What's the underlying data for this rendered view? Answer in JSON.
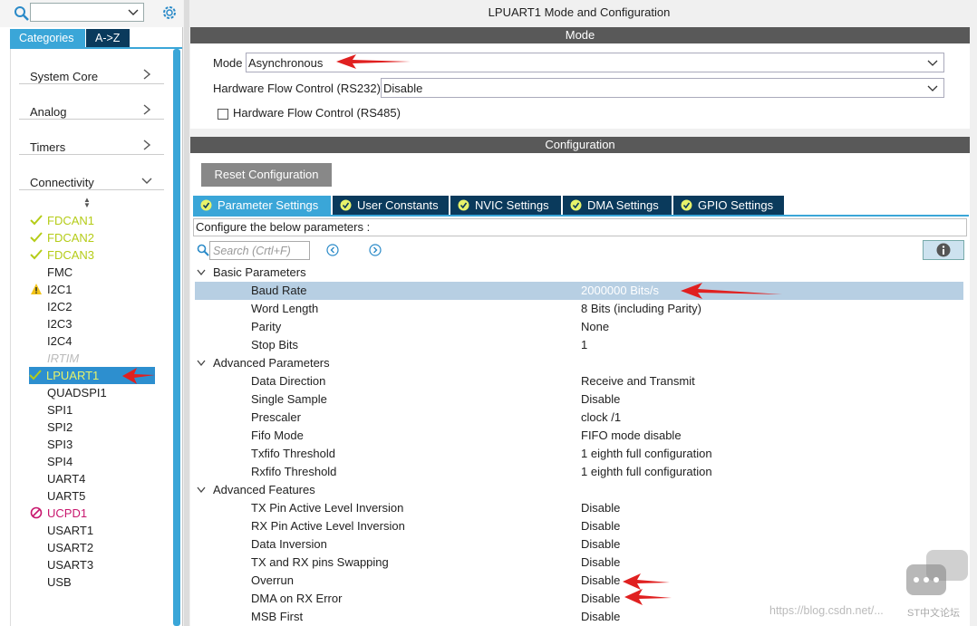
{
  "left": {
    "category_search": {
      "value": ""
    },
    "tabs": [
      {
        "label": "Categories"
      },
      {
        "label": "A->Z"
      }
    ],
    "categories": [
      {
        "label": "System Core",
        "state": "collapsed"
      },
      {
        "label": "Analog",
        "state": "collapsed"
      },
      {
        "label": "Timers",
        "state": "collapsed"
      },
      {
        "label": "Connectivity",
        "state": "expanded"
      }
    ],
    "peripherals": [
      {
        "label": "FDCAN1",
        "status": "ok"
      },
      {
        "label": "FDCAN2",
        "status": "ok"
      },
      {
        "label": "FDCAN3",
        "status": "ok"
      },
      {
        "label": "FMC",
        "status": "none"
      },
      {
        "label": "I2C1",
        "status": "warning"
      },
      {
        "label": "I2C2",
        "status": "none"
      },
      {
        "label": "I2C3",
        "status": "none"
      },
      {
        "label": "I2C4",
        "status": "none"
      },
      {
        "label": "IRTIM",
        "status": "disabled"
      },
      {
        "label": "LPUART1",
        "status": "ok",
        "selected": true
      },
      {
        "label": "QUADSPI1",
        "status": "none"
      },
      {
        "label": "SPI1",
        "status": "none"
      },
      {
        "label": "SPI2",
        "status": "none"
      },
      {
        "label": "SPI3",
        "status": "none"
      },
      {
        "label": "SPI4",
        "status": "none"
      },
      {
        "label": "UART4",
        "status": "none"
      },
      {
        "label": "UART5",
        "status": "none"
      },
      {
        "label": "UCPD1",
        "status": "error"
      },
      {
        "label": "USART1",
        "status": "none"
      },
      {
        "label": "USART2",
        "status": "none"
      },
      {
        "label": "USART3",
        "status": "none"
      },
      {
        "label": "USB",
        "status": "none"
      }
    ]
  },
  "right": {
    "title": "LPUART1 Mode and Configuration",
    "mode_header": "Mode",
    "mode_fields": {
      "mode_label": "Mode",
      "mode_value": "Asynchronous",
      "hfc232_label": "Hardware Flow Control (RS232)",
      "hfc232_value": "Disable",
      "hfc485_label": "Hardware Flow Control (RS485)"
    },
    "config_header": "Configuration",
    "reset_button": "Reset Configuration",
    "tabs": [
      {
        "label": "Parameter Settings",
        "active": true
      },
      {
        "label": "User Constants"
      },
      {
        "label": "NVIC Settings"
      },
      {
        "label": "DMA Settings"
      },
      {
        "label": "GPIO Settings"
      }
    ],
    "hint": "Configure the below parameters :",
    "param_search_placeholder": "Search (Crtl+F)",
    "groups": [
      {
        "label": "Basic Parameters",
        "params": [
          {
            "name": "Baud Rate",
            "value": "2000000 Bits/s",
            "highlighted": true
          },
          {
            "name": "Word Length",
            "value": "8 Bits (including Parity)"
          },
          {
            "name": "Parity",
            "value": "None"
          },
          {
            "name": "Stop Bits",
            "value": "1"
          }
        ]
      },
      {
        "label": "Advanced Parameters",
        "params": [
          {
            "name": "Data Direction",
            "value": "Receive and Transmit"
          },
          {
            "name": "Single Sample",
            "value": "Disable"
          },
          {
            "name": "Prescaler",
            "value": "clock /1"
          },
          {
            "name": "Fifo Mode",
            "value": "FIFO mode disable"
          },
          {
            "name": "Txfifo Threshold",
            "value": "1 eighth full configuration"
          },
          {
            "name": "Rxfifo Threshold",
            "value": "1 eighth full configuration"
          }
        ]
      },
      {
        "label": "Advanced Features",
        "params": [
          {
            "name": "TX Pin Active Level Inversion",
            "value": "Disable"
          },
          {
            "name": "RX Pin Active Level Inversion",
            "value": "Disable"
          },
          {
            "name": "Data Inversion",
            "value": "Disable"
          },
          {
            "name": "TX and RX pins Swapping",
            "value": "Disable"
          },
          {
            "name": "Overrun",
            "value": "Disable"
          },
          {
            "name": "DMA on RX Error",
            "value": "Disable"
          },
          {
            "name": "MSB First",
            "value": "Disable"
          }
        ]
      }
    ]
  },
  "watermark": "https://blog.csdn.net/...",
  "watermark_badge": "ST中文论坛",
  "colors": {
    "accent": "#3aa6d8",
    "nav_dark": "#0a3a5c",
    "ok": "#b5cc18",
    "error": "#c8176e",
    "annotation": "#e02020"
  }
}
